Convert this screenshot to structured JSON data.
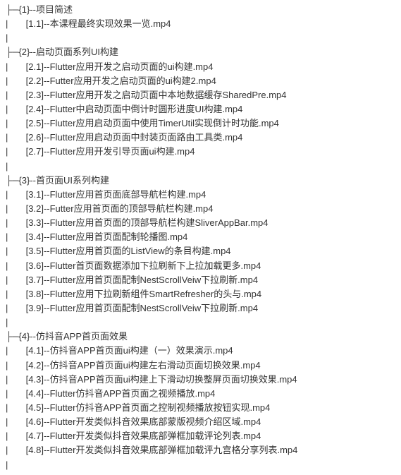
{
  "tree": {
    "sections": [
      {
        "num": "1",
        "title": "项目简述",
        "items": [
          {
            "num": "1.1",
            "label": "本课程最终实现效果一览.mp4"
          }
        ]
      },
      {
        "num": "2",
        "title": "启动页面系列UI构建",
        "items": [
          {
            "num": "2.1",
            "label": "Flutter应用开发之启动页面的ui构建.mp4"
          },
          {
            "num": "2.2",
            "label": "Futter应用开发之启动页面的ui构建2.mp4"
          },
          {
            "num": "2.3",
            "label": "Flutter应用开发之启动页面中本地数据缓存SharedPre.mp4"
          },
          {
            "num": "2.4",
            "label": "Flutter中启动页面中倒计时圆形进度UI构建.mp4"
          },
          {
            "num": "2.5",
            "label": "Flutter应用启动页面中使用TimerUtil实现倒计时功能.mp4"
          },
          {
            "num": "2.6",
            "label": "Flutter应用启动页面中封装页面路由工具类.mp4"
          },
          {
            "num": "2.7",
            "label": "Flutter应用开发引导页面ui构建.mp4"
          }
        ]
      },
      {
        "num": "3",
        "title": "首页面UI系列构建",
        "items": [
          {
            "num": "3.1",
            "label": "Flutter应用首页面底部导航栏构建.mp4"
          },
          {
            "num": "3.2",
            "label": "Futter应用首页面的顶部导航栏构建.mp4"
          },
          {
            "num": "3.3",
            "label": "Flutter应用首页面的顶部导航栏构建SliverAppBar.mp4"
          },
          {
            "num": "3.4",
            "label": "Flutter应用首页面配制轮播图.mp4"
          },
          {
            "num": "3.5",
            "label": "Flutter应用首页面的ListView的条目构建.mp4"
          },
          {
            "num": "3.6",
            "label": "Flutter首页面数据添加下拉刷新下上拉加载更多.mp4"
          },
          {
            "num": "3.7",
            "label": "Flutter应用首页面配制NestScrollVeiw下拉刷新.mp4"
          },
          {
            "num": "3.8",
            "label": "Flutter应用下拉刷新组件SmartRefresher的头与.mp4"
          },
          {
            "num": "3.9",
            "label": "Flutter应用首页面配制NestScrollVeiw下拉刷新.mp4"
          }
        ]
      },
      {
        "num": "4",
        "title": "仿抖音APP首页面效果",
        "items": [
          {
            "num": "4.1",
            "label": "仿抖音APP首页面ui构建（一）效果演示.mp4"
          },
          {
            "num": "4.2",
            "label": "仿抖音APP首页面ui构建左右滑动页面切换效果.mp4"
          },
          {
            "num": "4.3",
            "label": "仿抖音APP首页面ui构建上下滑动切换整屏页面切换效果.mp4"
          },
          {
            "num": "4.4",
            "label": "Flutter仿抖音APP首页面之视频播放.mp4"
          },
          {
            "num": "4.5",
            "label": "Flutter仿抖音APP首页面之控制视频播放按钮实现.mp4"
          },
          {
            "num": "4.6",
            "label": "Flutter开发类似抖音效果底部蒙版视频介绍区域.mp4"
          },
          {
            "num": "4.7",
            "label": "Flutter开发类似抖音效果底部弹框加载评论列表.mp4"
          },
          {
            "num": "4.8",
            "label": "Flutter开发类似抖音效果底部弹框加载评九宫格分享列表.mp4"
          }
        ]
      }
    ]
  }
}
